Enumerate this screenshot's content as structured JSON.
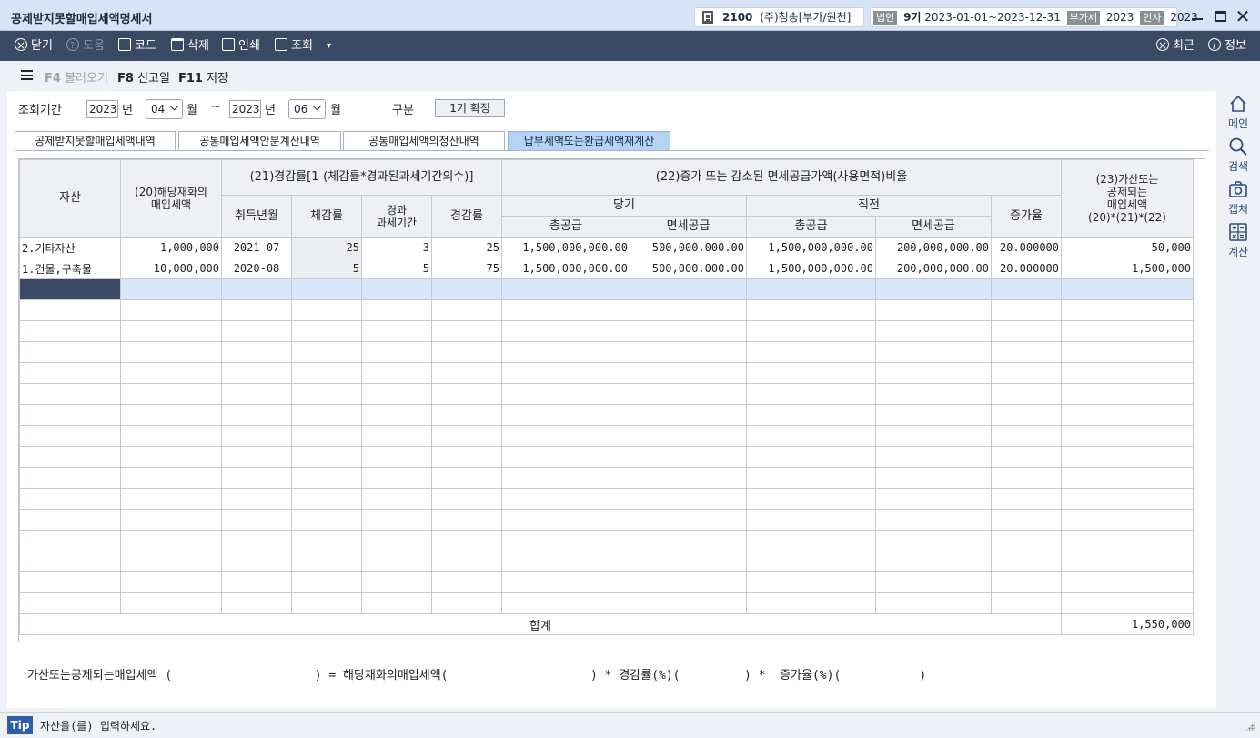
{
  "window": {
    "title": "공제받지못할매입세액명세서",
    "company_code": "2100",
    "company_name": "(주)청송[부가/원천]",
    "corp_tag": "법인",
    "period_num": "9기",
    "period_range": "2023-01-01~2023-12-31",
    "vat_tag": "부가세",
    "vat_year": "2023",
    "hr_tag": "인사",
    "hr_year": "2023"
  },
  "toolbar": {
    "close": "닫기",
    "help": "도움",
    "code": "코드",
    "delete": "삭제",
    "print": "인쇄",
    "search": "조회",
    "recent": "최근",
    "info": "정보"
  },
  "fnbar": {
    "f4_key": "F4",
    "f4_label": "불러오기",
    "f8_key": "F8",
    "f8_label": "신고일",
    "f11_key": "F11",
    "f11_label": "저장"
  },
  "filter": {
    "period_label": "조회기간",
    "from_year": "2023",
    "year_unit": "년",
    "from_month": "04",
    "month_unit": "월",
    "tilde": "~",
    "to_year": "2023",
    "to_month": "06",
    "gubun_label": "구분",
    "gubun_value": "1기 확정"
  },
  "tabs": [
    "공제받지못할매입세액내역",
    "공통매입세액안분계산내역",
    "공통매입세액의정산내역",
    "납부세액또는환급세액재계산"
  ],
  "grid": {
    "headers": {
      "asset": "자산",
      "h20": "(20)해당재화의\n매입세액",
      "h21": "(21)경감률[1-(체감률*경과된과세기간의수)]",
      "acq": "취득년월",
      "dep": "체감률",
      "elapsed": "경과\n과세기간",
      "reduction": "경감률",
      "h22": "(22)증가 또는 감소된 면세공급가액(사용면적)비율",
      "current": "당기",
      "previous": "직전",
      "total_supply": "총공급",
      "exempt_supply": "면세공급",
      "increase": "증가율",
      "h23": "(23)가산또는\n공제되는\n매입세액\n(20)*(21)*(22)"
    },
    "rows": [
      {
        "asset": "2.기타자산",
        "tax": "1,000,000",
        "acq": "2021-07",
        "dep": "25",
        "elapsed": "3",
        "reduction": "25",
        "cur_total": "1,500,000,000.00",
        "cur_exempt": "500,000,000.00",
        "prev_total": "1,500,000,000.00",
        "prev_exempt": "200,000,000.00",
        "increase": "20.000000",
        "result": "50,000"
      },
      {
        "asset": "1.건물,구축물",
        "tax": "10,000,000",
        "acq": "2020-08",
        "dep": "5",
        "elapsed": "5",
        "reduction": "75",
        "cur_total": "1,500,000,000.00",
        "cur_exempt": "500,000,000.00",
        "prev_total": "1,500,000,000.00",
        "prev_exempt": "200,000,000.00",
        "increase": "20.000000",
        "result": "1,500,000"
      }
    ],
    "total_label": "합계",
    "total_value": "1,550,000"
  },
  "formula": {
    "text": "가산또는공제되는매입세액 (                    ) = 해당재화의매입세액(                    ) * 경감률(%)(         ) *  증가율(%)(           )"
  },
  "sidebar": {
    "home": "메인",
    "search": "검색",
    "capture": "캡처",
    "calc": "계산"
  },
  "status": {
    "tip": "Tip",
    "message": "자산을(를) 입력하세요."
  }
}
